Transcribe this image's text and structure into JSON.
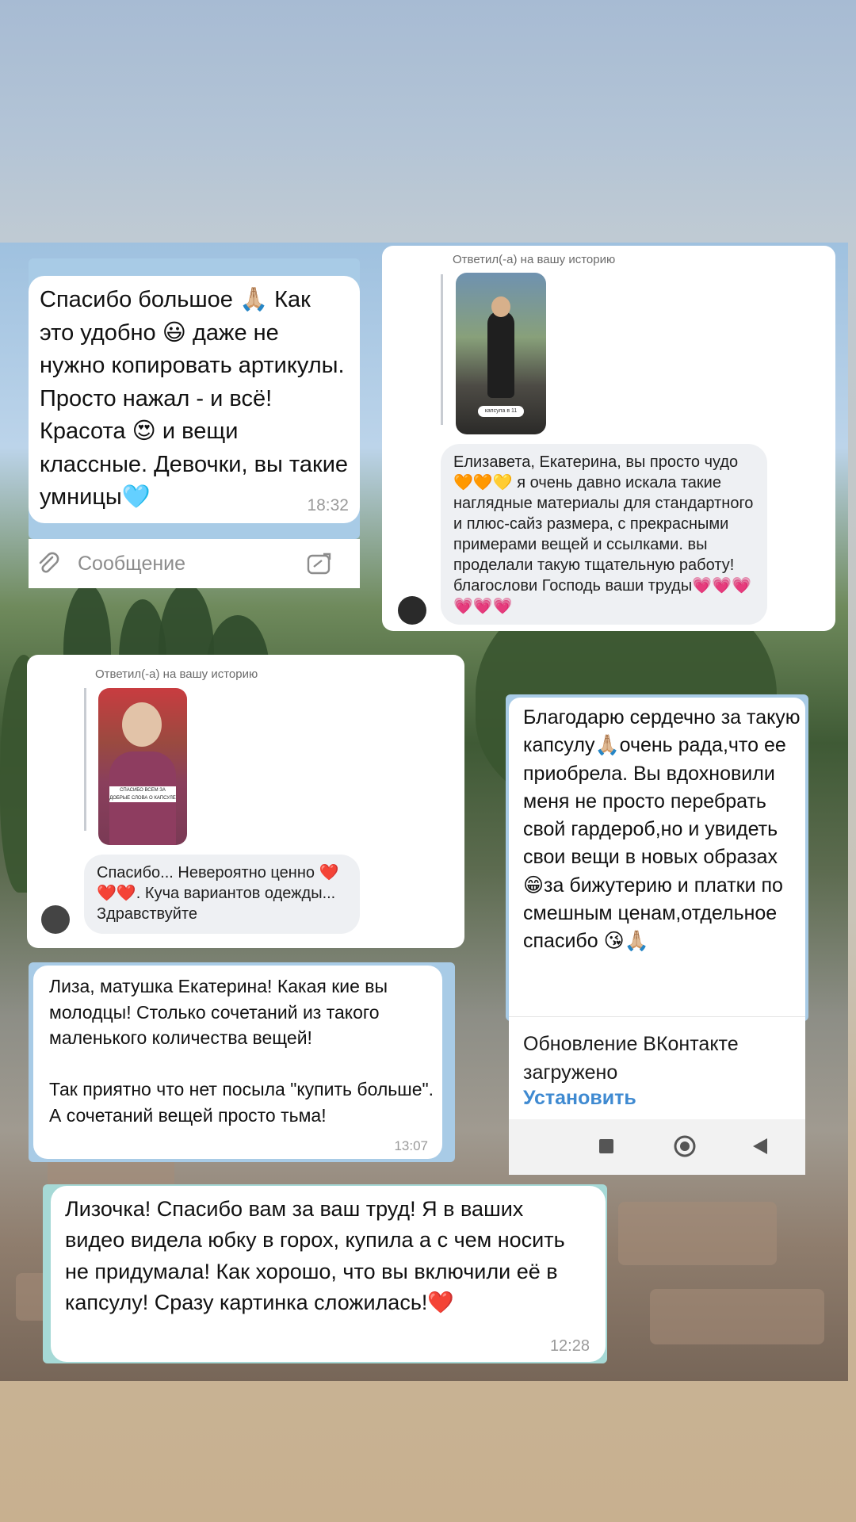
{
  "messages": {
    "m1": {
      "text": "Спасибо большое 🙏🏼 Как это удобно 😃 даже не нужно копировать артикулы. Просто нажал - и всё! Красота 😍 и вещи классные. Девочки, вы такие умницы🩵",
      "time": "18:32"
    },
    "m1_input": {
      "placeholder": "Сообщение"
    },
    "m2": {
      "reply_label": "Ответил(-а) на вашу историю",
      "story_text": "капсула в 11",
      "text": "Елизавета, Екатерина, вы просто чудо 🧡🧡💛 я очень давно искала такие наглядные материалы для стандартного и плюс-сайз размера, с прекрасными примерами вещей и ссылками. вы проделали такую тщательную работу! благослови Господь ваши труды💗💗💗💗💗💗"
    },
    "m3": {
      "reply_label": "Ответил(-а) на вашу историю",
      "story_text": "СПАСИБО ВСЕМ ЗА ДОБРЫЕ СЛОВА О КАПСУЛЕ",
      "text": "Спасибо... Невероятно ценно ❤️❤️❤️. Куча вариантов одежды... Здравствуйте"
    },
    "m4": {
      "text": "Благодарю сердечно за такую капсулу🙏🏼очень рада,что ее приобрела. Вы вдохновили меня не просто перебрать свой гардероб,но и увидеть свои вещи в новых образах 😁за бижутерию и платки по смешным ценам,отдельное спасибо 😘🙏🏼",
      "update_text": "Обновление ВКонтакте загружено",
      "install_label": "Установить"
    },
    "m5": {
      "text": "Лиза, матушка Екатерина! Какая кие вы молодцы! Столько сочетаний из такого маленького количества вещей!\n\nТак приятно что нет посыла \"купить больше\". А сочетаний вещей просто тьма!",
      "time": "13:07"
    },
    "m6": {
      "text": "Лизочка! Спасибо вам за ваш труд! Я в ваших видео видела юбку в горох, купила а с чем носить не придумала! Как хорошо, что вы включили её в капсулу! Сразу картинка сложилась!❤️",
      "time": "12:28"
    }
  },
  "colors": {
    "accent_link": "#3f8ad1",
    "vk_bubble": "#eef0f3",
    "tg_border": "#a8cbe6"
  },
  "icons": [
    "paperclip-icon",
    "sticker-icon",
    "stop-square-icon",
    "home-circle-icon",
    "back-triangle-icon"
  ]
}
